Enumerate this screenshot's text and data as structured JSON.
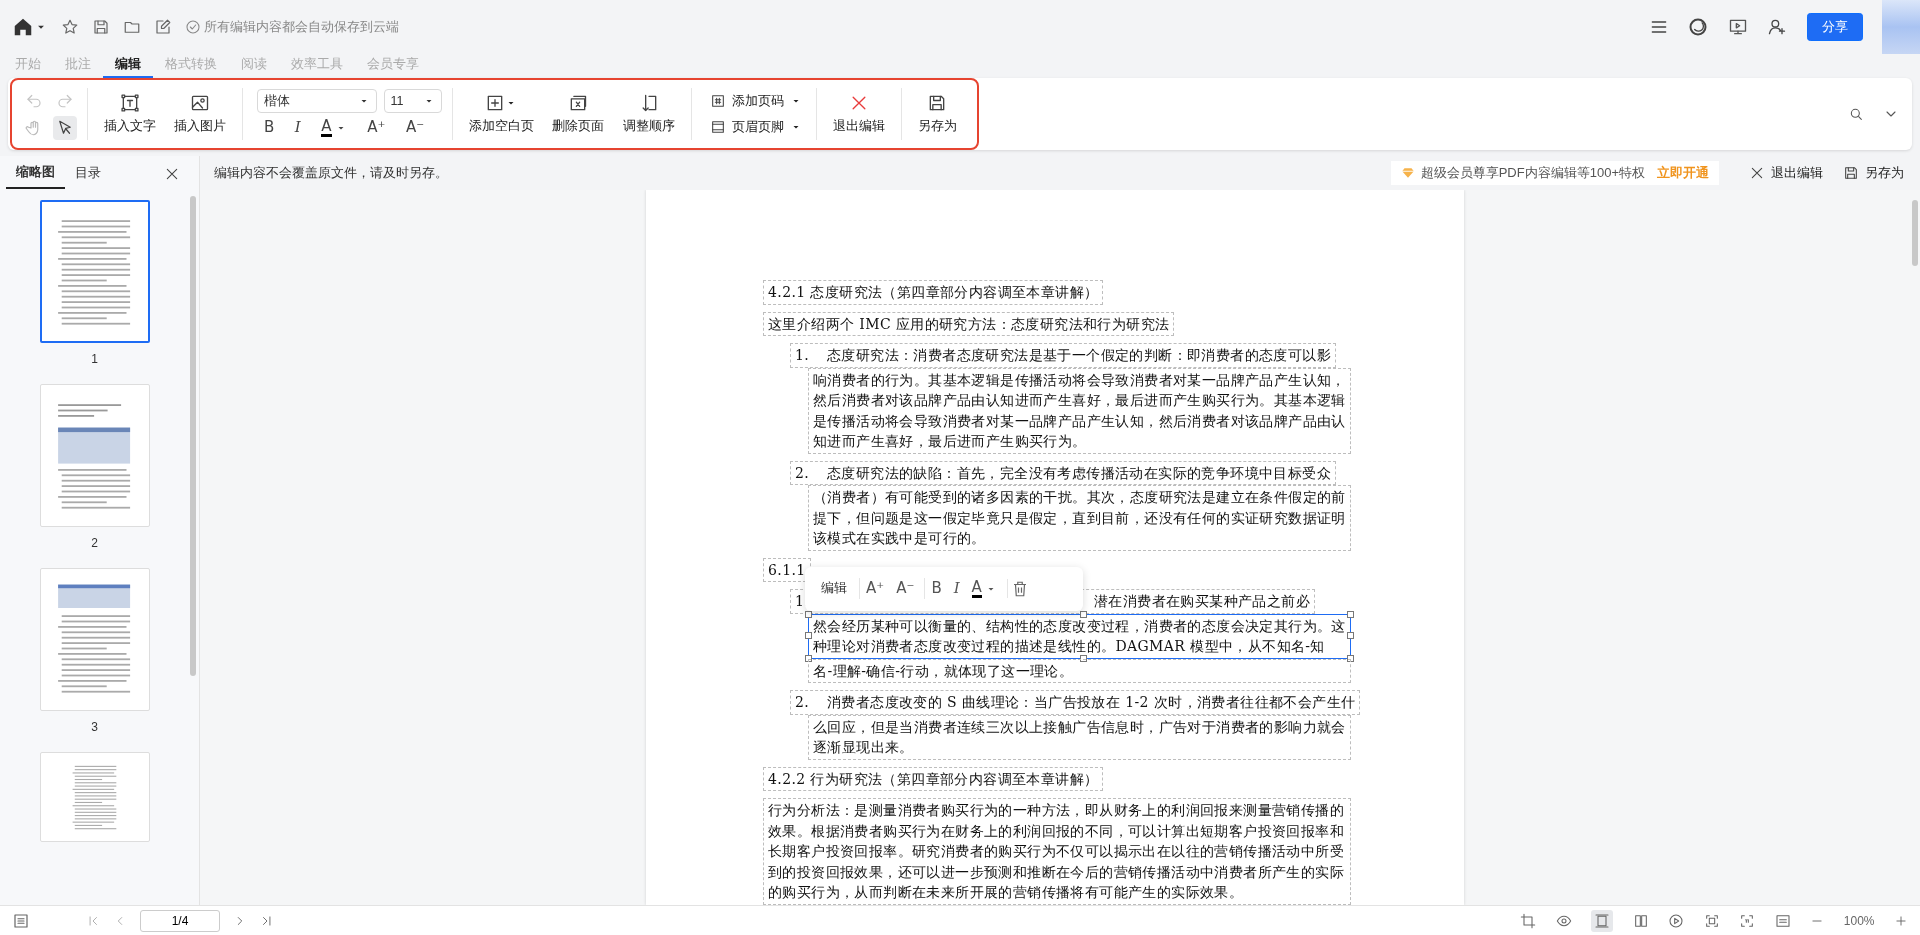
{
  "top_bar": {
    "save_status": "所有编辑内容都会自动保存到云端",
    "share_button": "分享"
  },
  "menu_tabs": [
    {
      "label": "开始",
      "selected": false
    },
    {
      "label": "批注",
      "selected": false
    },
    {
      "label": "编辑",
      "selected": true
    },
    {
      "label": "格式转换",
      "selected": false
    },
    {
      "label": "阅读",
      "selected": false
    },
    {
      "label": "效率工具",
      "selected": false
    },
    {
      "label": "会员专享",
      "selected": false
    }
  ],
  "toolbar": {
    "undo": {
      "disabled": true
    },
    "redo": {
      "disabled": true
    },
    "tools": [
      {
        "kind": "hand",
        "selected": false
      },
      {
        "kind": "select",
        "selected": true
      }
    ],
    "insert": [
      {
        "kind": "text",
        "label": "插入文字"
      },
      {
        "kind": "image",
        "label": "插入图片"
      }
    ],
    "font_family": "楷体",
    "font_size": "11",
    "format": [
      {
        "kind": "bold",
        "label": "B"
      },
      {
        "kind": "italic",
        "label": "I"
      },
      {
        "kind": "color",
        "label": "A"
      },
      {
        "kind": "grow",
        "label": "A⁺"
      },
      {
        "kind": "shrink",
        "label": "A⁻"
      }
    ],
    "page_tools": [
      {
        "kind": "add",
        "label": "添加空白页"
      },
      {
        "kind": "delete",
        "label": "删除页面"
      },
      {
        "kind": "reorder",
        "label": "调整顺序"
      }
    ],
    "page_menus": [
      {
        "kind": "number",
        "label": "添加页码"
      },
      {
        "kind": "header",
        "label": "页眉页脚"
      }
    ],
    "exit_button": "退出编辑",
    "save_as_button": "另存为"
  },
  "notice_bar": {
    "message": "编辑内容不会覆盖原文件，请及时另存。",
    "promo": "超级会员尊享PDF内容编辑等100+特权",
    "promo_link": "立即开通",
    "exit": "退出编辑",
    "save_as": "另存为"
  },
  "sidebar": {
    "tabs": [
      {
        "label": "缩略图",
        "selected": true
      },
      {
        "label": "目录",
        "selected": false
      }
    ],
    "thumbnails": [
      {
        "kind": "text",
        "page": "1",
        "selected": true
      },
      {
        "kind": "table",
        "page": "2",
        "selected": false
      },
      {
        "kind": "top_table",
        "page": "3",
        "selected": false
      },
      {
        "kind": "text",
        "selected": false
      }
    ]
  },
  "document": {
    "blocks": [
      {
        "kind": "heading",
        "text": "4.2.1 态度研究法（第四章部分内容调至本章讲解）"
      },
      {
        "kind": "paragraph",
        "text": "这里介绍两个 IMC 应用的研究方法：态度研究法和行为研究法"
      },
      {
        "kind": "list_item",
        "number": "1.",
        "chunks": [
          {
            "text": "态度研究法：消费者态度研究法是基于一个假定的判断：即消费者的态度可以影",
            "selected": false
          },
          {
            "text": "响消费者的行为。其基本逻辑是传播活动将会导致消费者对某一品牌产品产生认知，然后消费者对该品牌产品由认知进而产生喜好，最后进而产生购买行为。其基本逻辑是传播活动将会导致消费者对某一品牌产品产生认知，然后消费者对该品牌产品由认知进而产生喜好，最后进而产生购买行为。",
            "selected": false
          }
        ]
      },
      {
        "kind": "list_item",
        "number": "2.",
        "chunks": [
          {
            "text": "态度研究法的缺陷：首先，完全没有考虑传播活动在实际的竞争环境中目标受众",
            "selected": false
          },
          {
            "text": "（消费者）有可能受到的诸多因素的干扰。其次，态度研究法是建立在条件假定的前提下，但问题是这一假定毕竟只是假定，直到目前，还没有任何的实证研究数据证明该模式在实践中是可行的。",
            "selected": false
          }
        ]
      },
      {
        "kind": "heading",
        "text": "6.1.1"
      },
      {
        "kind": "list_item",
        "number": "1.",
        "chunks": [
          {
            "text": "潜在消费者在购买某种产品之前必",
            "selected": false,
            "covered": true
          },
          {
            "text": "然会经历某种可以衡量的、结构性的态度改变过程，消费者的态度会决定其行为。这种理论对消费者态度改变过程的描述是线性的。DAGMAR 模型中，从不知名-知",
            "selected": true
          },
          {
            "text": "名-理解-确信-行动，就体现了这一理论。",
            "selected": false
          }
        ]
      },
      {
        "kind": "list_item",
        "number": "2.",
        "chunks": [
          {
            "text": "消费者态度改变的 S 曲线理论：当广告投放在 1-2 次时，消费者往往都不会产生什",
            "selected": false
          },
          {
            "text": "么回应，但是当消费者连续三次以上接触广告信息时，广告对于消费者的影响力就会逐渐显现出来。",
            "selected": false
          }
        ]
      },
      {
        "kind": "heading",
        "text": "4.2.2 行为研究法（第四章部分内容调至本章讲解）"
      },
      {
        "kind": "paragraph",
        "text": "行为分析法：是测量消费者购买行为的一种方法，即从财务上的利润回报来测量营销传播的效果。根据消费者购买行为在财务上的利润回报的不同，可以计算出短期客户投资回报率和长期客户投资回报率。研究消费者的购买行为不仅可以揭示出在以往的营销传播活动中所受到的投资回报效果，还可以进一步预测和推断在今后的营销传播活动中消费者所产生的实际的购买行为，从而判断在未来所开展的营销传播将有可能产生的实际效果。"
      }
    ]
  },
  "popup_toolbar": {
    "label": "编辑",
    "format": [
      {
        "kind": "grow",
        "label": "A⁺"
      },
      {
        "kind": "shrink",
        "label": "A⁻"
      },
      {
        "kind": "bold",
        "label": "B"
      },
      {
        "kind": "italic",
        "label": "I"
      },
      {
        "kind": "color",
        "label": "A"
      }
    ]
  },
  "status_bar": {
    "page": "1/4",
    "zoom": "100%"
  }
}
